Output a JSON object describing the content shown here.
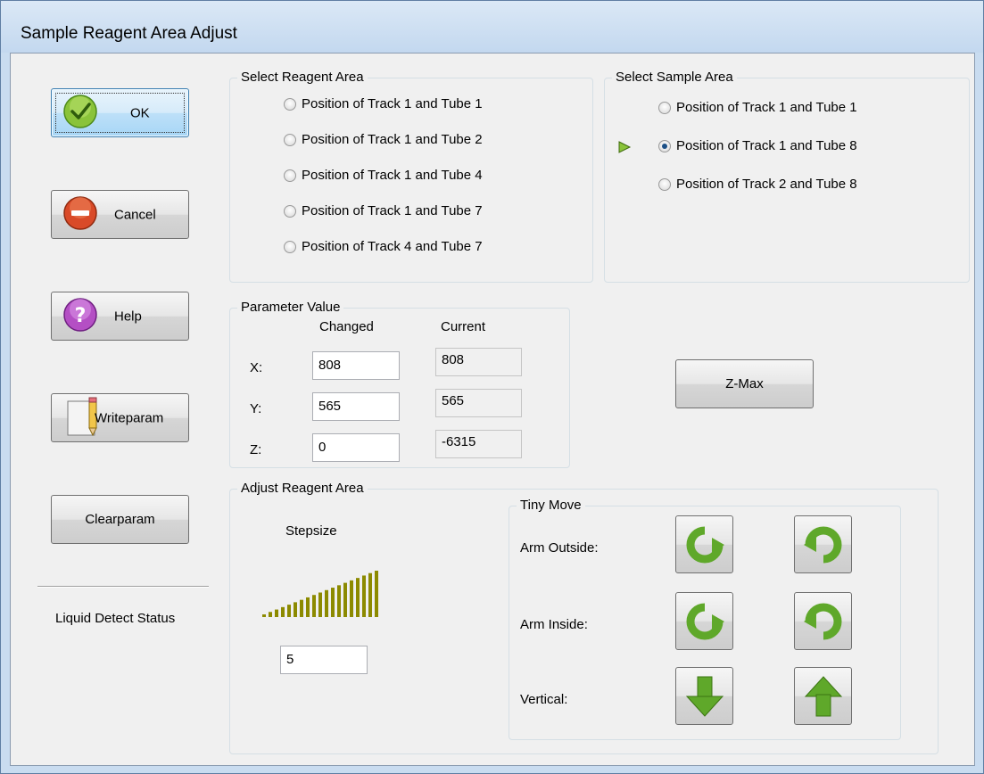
{
  "window": {
    "title": "Sample Reagent Area Adjust"
  },
  "buttons": {
    "ok": "OK",
    "cancel": "Cancel",
    "help": "Help",
    "writeparam": "Writeparam",
    "clearparam": "Clearparam",
    "zmax": "Z-Max"
  },
  "liquid_detect_status": "Liquid Detect Status",
  "reagent_area": {
    "title": "Select Reagent Area",
    "options": [
      {
        "label": "Position of Track 1 and Tube 1",
        "checked": false
      },
      {
        "label": "Position of Track 1 and Tube 2",
        "checked": false
      },
      {
        "label": "Position of Track 1 and Tube 4",
        "checked": false
      },
      {
        "label": "Position of Track 1 and Tube 7",
        "checked": false
      },
      {
        "label": "Position of Track 4 and Tube 7",
        "checked": false
      }
    ]
  },
  "sample_area": {
    "title": "Select Sample Area",
    "options": [
      {
        "label": "Position of Track 1 and Tube 1",
        "checked": false
      },
      {
        "label": "Position of Track 1 and Tube 8",
        "checked": true
      },
      {
        "label": "Position of Track 2 and Tube 8",
        "checked": false
      }
    ]
  },
  "parameter": {
    "title": "Parameter Value",
    "col_changed": "Changed",
    "col_current": "Current",
    "rows": [
      {
        "axis": "X:",
        "changed": "808",
        "current": "808"
      },
      {
        "axis": "Y:",
        "changed": "565",
        "current": "565"
      },
      {
        "axis": "Z:",
        "changed": "0",
        "current": "-6315"
      }
    ]
  },
  "adjust": {
    "title": "Adjust Reagent Area",
    "stepsize_label": "Stepsize",
    "stepsize_value": "5",
    "stepsize_level": 5,
    "stepsize_max": 20
  },
  "tiny_move": {
    "title": "Tiny Move",
    "rows": [
      {
        "label": "Arm Outside:"
      },
      {
        "label": "Arm Inside:"
      },
      {
        "label": "Vertical:"
      }
    ]
  },
  "colors": {
    "arrow_green": "#5fa82a",
    "slider_olive": "#8c8a00",
    "ok_green": "#8ac33a",
    "cancel_red": "#d94a28",
    "help_purple": "#b44fc4"
  },
  "icons": {
    "ok": "check-icon",
    "cancel": "minus-icon",
    "help": "question-icon",
    "writeparam": "pencil-icon",
    "selected_marker": "triangle-right-icon"
  }
}
